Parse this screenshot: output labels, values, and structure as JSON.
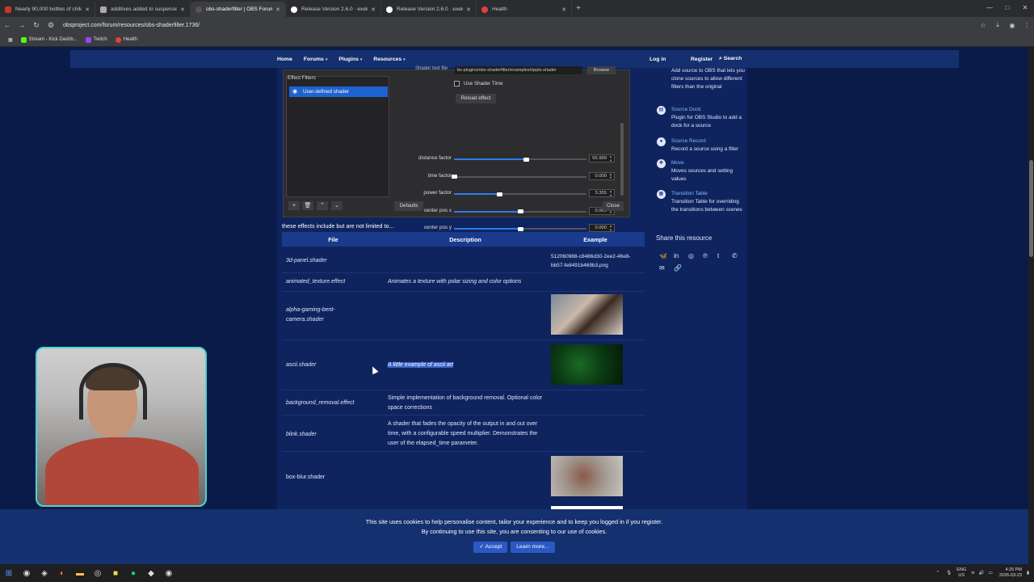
{
  "browser": {
    "tabs": [
      {
        "label": "Nearly 90,000 bottles of childr",
        "color": "#c0392b",
        "active": false
      },
      {
        "label": "additives added to suspension",
        "color": "#aaaaaa",
        "active": false
      },
      {
        "label": "obs-shaderfilter | OBS Forums",
        "color": "#555555",
        "active": true
      },
      {
        "label": "Release Version 2.6.0 · exeldro/",
        "color": "#ffffff",
        "active": false
      },
      {
        "label": "Release Version 2.6.0 · exeldro/",
        "color": "#ffffff",
        "active": false
      },
      {
        "label": "Health",
        "color": "#e04040",
        "active": false
      }
    ],
    "url": "obsproject.com/forum/resources/obs-shaderfilter.1736/",
    "bookmarks": [
      "Stream - Kick Dashb...",
      "Twitch",
      "Health"
    ]
  },
  "site_nav": {
    "items": [
      "Home",
      "Forums",
      "Plugins",
      "Resources"
    ],
    "login": "Log in",
    "register": "Register",
    "search": "Search"
  },
  "obs_dialog": {
    "shader_text_label": "Shader text file",
    "shader_path": "bs-plugins/obs-shaderfilter/examples/ripple.shader",
    "browse": "Browse",
    "use_shader_time": "Use Shader Time",
    "reload": "Reload effect",
    "effect_filters_title": "Effect Filters",
    "effect_item": "User-defined shader",
    "params": [
      {
        "label": "distance factor",
        "value": "55.999",
        "fill": 0.54
      },
      {
        "label": "time factor",
        "value": "0.000",
        "fill": 0.0
      },
      {
        "label": "power factor",
        "value": "3.355",
        "fill": 0.34
      },
      {
        "label": "center pos x",
        "value": "0.000",
        "fill": 0.5
      },
      {
        "label": "center pos y",
        "value": "0.000",
        "fill": 0.5
      }
    ],
    "defaults": "Defaults",
    "close": "Close"
  },
  "content": {
    "intro": "these effects include but are not limited to...",
    "headers": {
      "file": "File",
      "description": "Description",
      "example": "Example"
    },
    "rows": [
      {
        "file": "3d-panel.shader",
        "desc": "",
        "example": "512060988-c8486d30-2ee2-46e8-bb57-fe8491b469b3.png"
      },
      {
        "file": "animated_texture.effect",
        "desc": "Animates a texture with polar sizing and color options"
      },
      {
        "file": "alpha-gaming-bent-camera.shader",
        "desc": ""
      },
      {
        "file": "ascii.shader",
        "desc": "A little example of ascii art"
      },
      {
        "file": "background_removal.effect",
        "desc": "Simple implementation of background removal. Optional color space corrections"
      },
      {
        "file": "blink.shader",
        "desc": "A shader that fades the opacity of the output in and out over time, with a configurable speed multiplier. Demonstrates the user of the elapsed_time parameter."
      },
      {
        "file": "box-blur.shader",
        "desc": ""
      }
    ]
  },
  "sidebar": {
    "items": [
      {
        "title": "",
        "desc": "Add source to OBS that lets you clone sources to allow different filters than the original"
      },
      {
        "title": "Source Dock",
        "desc": "Plugin for OBS Studio to add a dock for a source"
      },
      {
        "title": "Source Record",
        "desc": "Record a source using a filter"
      },
      {
        "title": "Move",
        "desc": "Moves sources and setting values"
      },
      {
        "title": "Transition Table",
        "desc": "Transition Table for overriding the transitions between scenes"
      }
    ],
    "share_title": "Share this resource",
    "share_icons": [
      "bluesky-icon",
      "linkedin-icon",
      "reddit-icon",
      "pinterest-icon",
      "tumblr-icon",
      "whatsapp-icon",
      "email-icon",
      "link-icon"
    ]
  },
  "cookie": {
    "line1": "This site uses cookies to help personalise content, tailor your experience and to keep you logged in if you register.",
    "line2": "By continuing to use this site, you are consenting to our use of cookies.",
    "accept": "Accept",
    "learn_more": "Learn more..."
  },
  "taskbar": {
    "lang": "ENG",
    "region": "US",
    "time": "4:25 PM",
    "date": "2026-03-23"
  }
}
